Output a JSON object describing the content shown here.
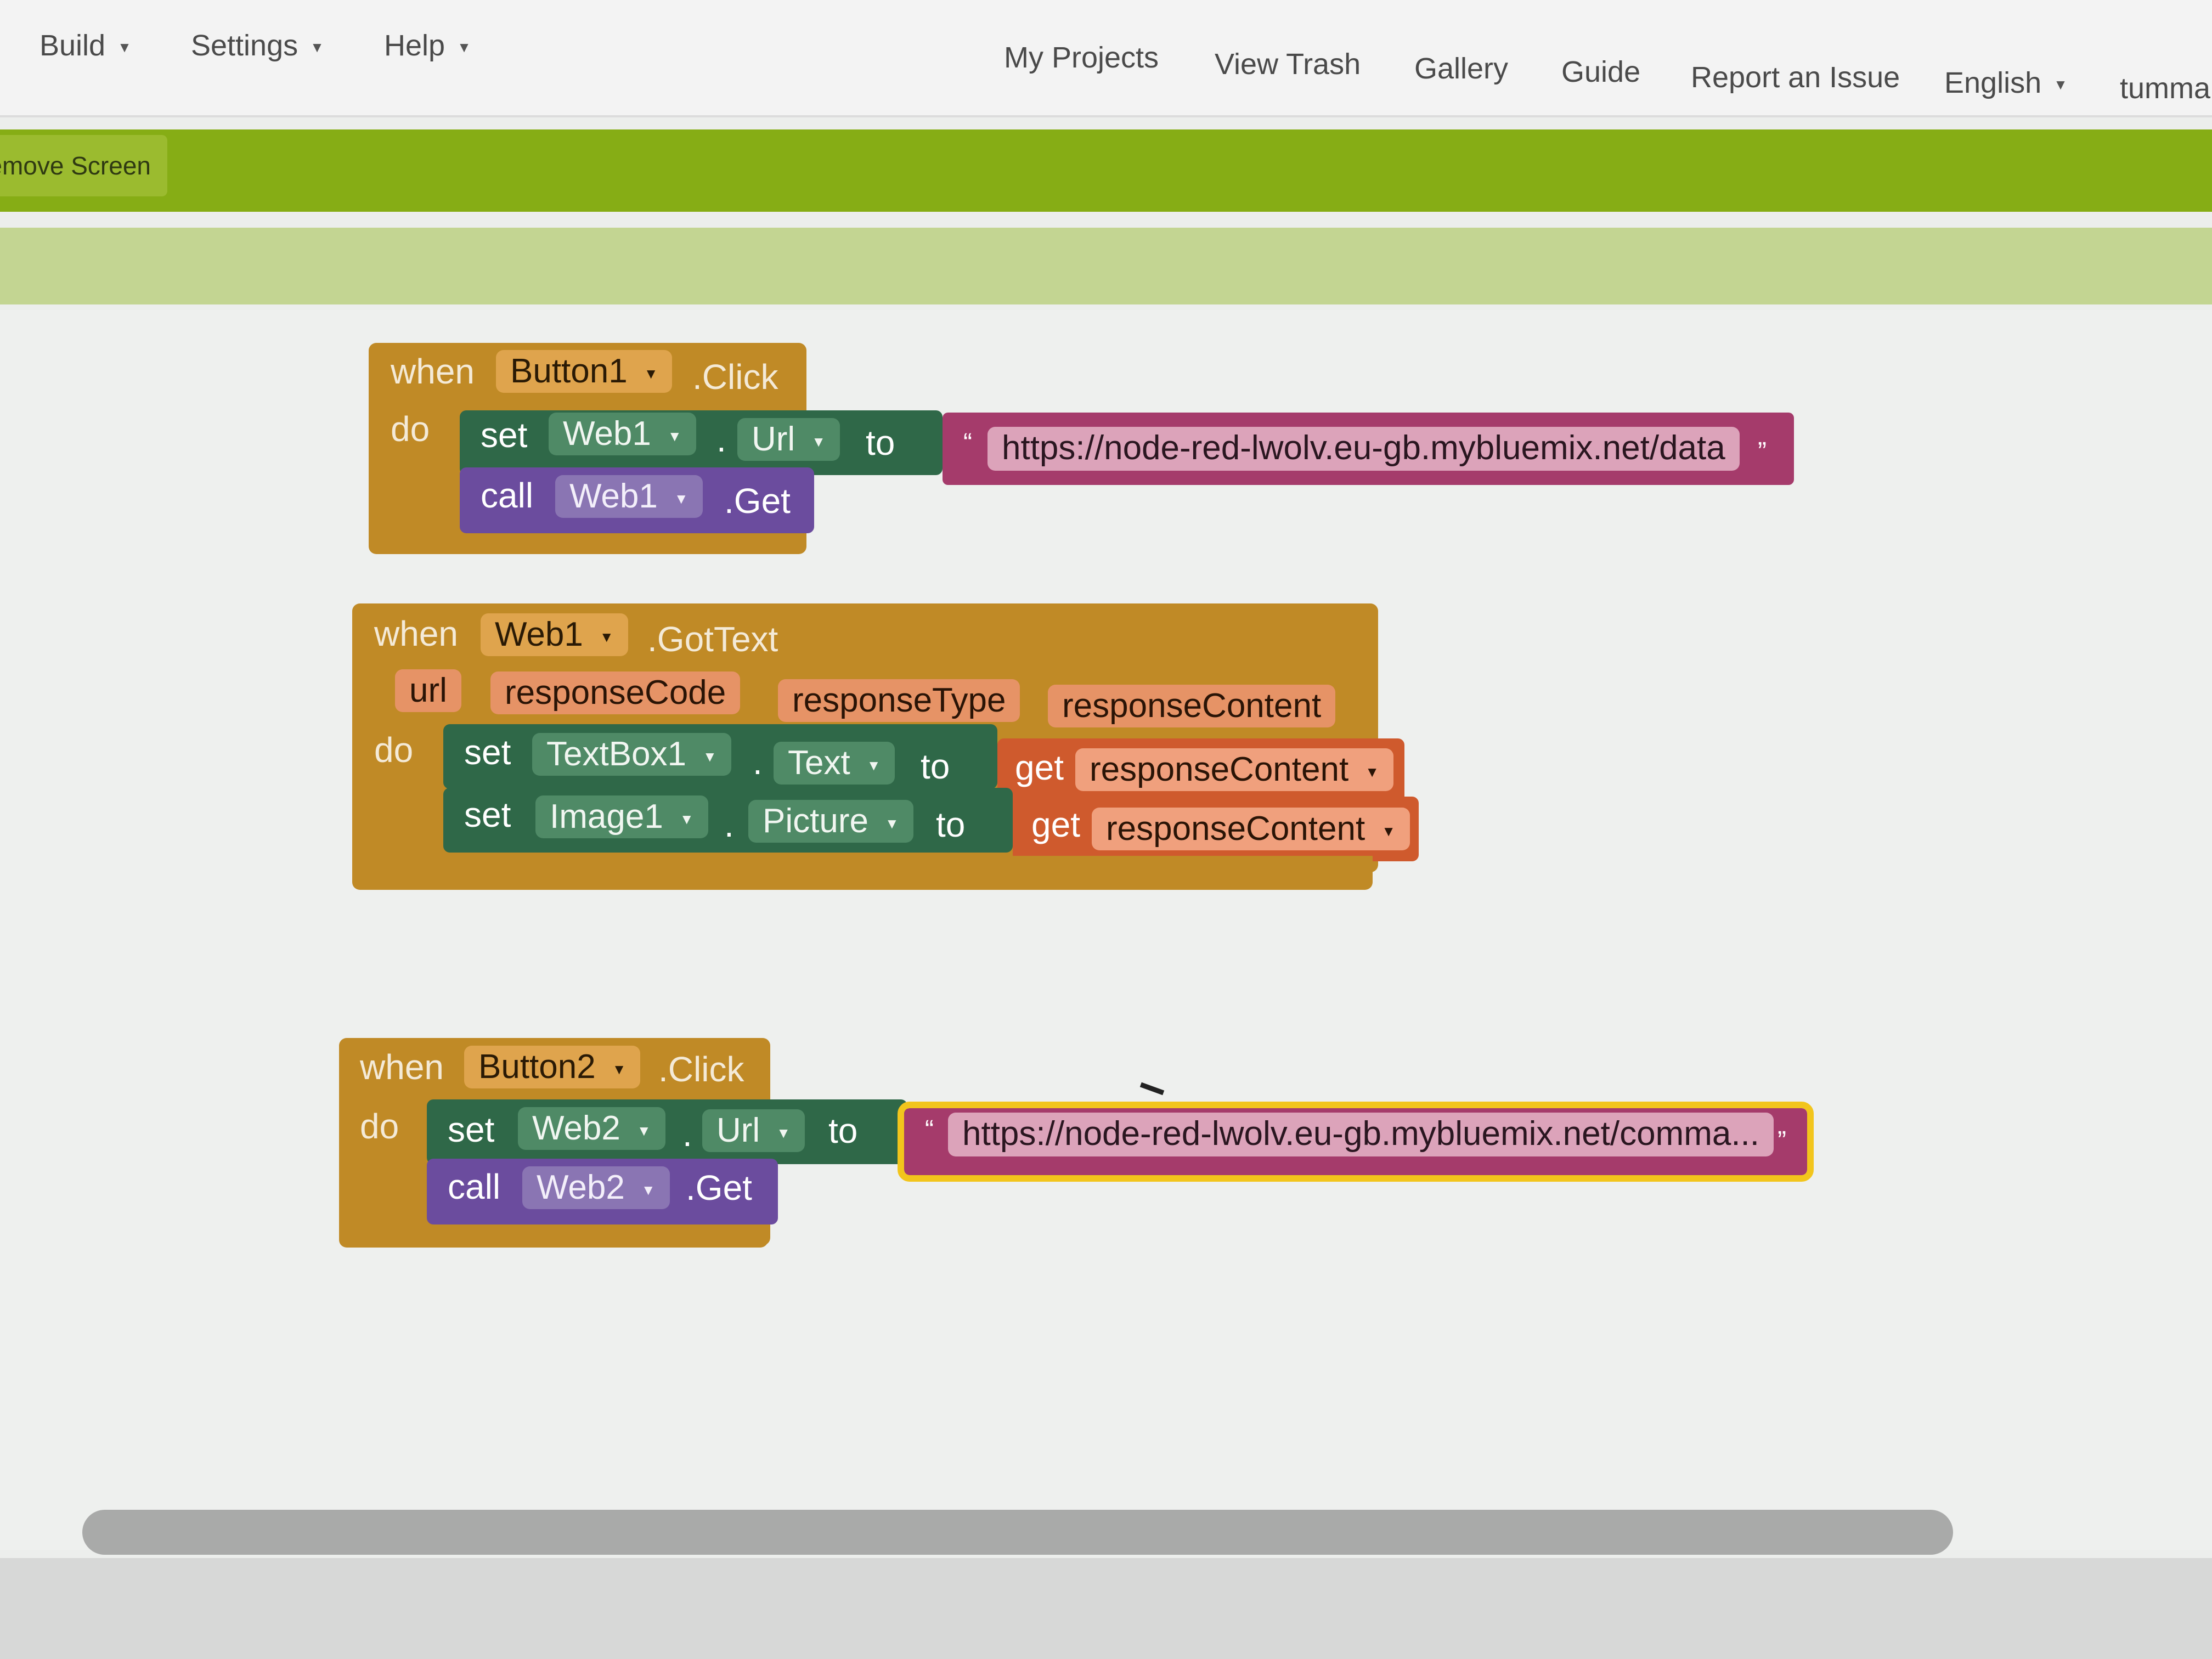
{
  "menu": {
    "build": "Build",
    "settings": "Settings",
    "help": "Help",
    "my_projects": "My Projects",
    "view_trash": "View Trash",
    "gallery": "Gallery",
    "guide": "Guide",
    "report_issue": "Report an Issue",
    "language": "English",
    "user": "tumma"
  },
  "toolbar": {
    "remove_screen": "emove Screen"
  },
  "blocks": {
    "b1": {
      "when": "when",
      "component": "Button1",
      "event": ".Click",
      "do": "do",
      "set": "set",
      "set_component": "Web1",
      "dot": ".",
      "property": "Url",
      "to": "to",
      "url": "https://node-red-lwolv.eu-gb.mybluemix.net/data",
      "call": "call",
      "call_component": "Web1",
      "method": ".Get"
    },
    "b2": {
      "when": "when",
      "component": "Web1",
      "event": ".GotText",
      "params": [
        "url",
        "responseCode",
        "responseType",
        "responseContent"
      ],
      "do": "do",
      "set1": {
        "set": "set",
        "component": "TextBox1",
        "dot": ".",
        "property": "Text",
        "to": "to",
        "get": "get",
        "var": "responseContent"
      },
      "set2": {
        "set": "set",
        "component": "Image1",
        "dot": ".",
        "property": "Picture",
        "to": "to",
        "get": "get",
        "var": "responseContent"
      }
    },
    "b3": {
      "when": "when",
      "component": "Button2",
      "event": ".Click",
      "do": "do",
      "set": "set",
      "set_component": "Web2",
      "dot": ".",
      "property": "Url",
      "to": "to",
      "url": "https://node-red-lwolv.eu-gb.mybluemix.net/comma...",
      "call": "call",
      "call_component": "Web2",
      "method": ".Get"
    }
  },
  "quotes": {
    "open": "“",
    "close": "”"
  },
  "icons": {
    "dropdown": "dropdown-caret-icon"
  },
  "colors": {
    "event_block": "#c08a26",
    "set_block": "#2f6848",
    "call_block": "#6b4c9e",
    "get_block": "#cf5a2d",
    "string_block": "#a53b6b",
    "green_toolbar": "#86ad15"
  }
}
